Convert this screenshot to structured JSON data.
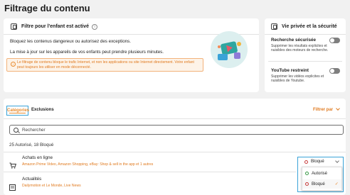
{
  "page": {
    "title": "Filtrage du contenu"
  },
  "child_filter": {
    "title": "Filtre pour l'enfant est activé",
    "line1": "Bloquez les contenus dangereux ou autorisez des exceptions.",
    "line2": "La mise à jour sur les appareils de vos enfants peut prendre plusieurs minutes.",
    "notice": "Le filtrage de contenu bloque le trafic Internet, et non les applications ou site Internet directement. Votre enfant peut toujours les utiliser en mode déconnecté."
  },
  "privacy": {
    "title": "Vie privée et la sécurité",
    "items": [
      {
        "title": "Recherche sécurisée",
        "desc": "Supprimer les résultats explicites et nuisibles des moteurs de recherche."
      },
      {
        "title": "YouTube restreint",
        "desc": "Supprimer les vidéos explicites et nuisibles de Youtube."
      }
    ]
  },
  "tabs": {
    "categories": "Catégories",
    "exclusions": "Exclusions",
    "filter_by": "Filtrer par"
  },
  "search": {
    "placeholder": "Rechercher"
  },
  "summary": {
    "count": "25 Autorisé, 18 Bloqué"
  },
  "categories": [
    {
      "title": "Achats en ligne",
      "sites": "Amazon Prime Video, Amazon Shopping, eBay: Shop & sell in the app et 1 autres",
      "status": "Bloqué"
    },
    {
      "title": "Actualités",
      "sites": "Dailymotion et Le Monde, Live News"
    }
  ],
  "status_options": [
    {
      "label": "Autorisé",
      "color": "#3a9a46"
    },
    {
      "label": "Bloqué",
      "color": "#c83c3c",
      "check": "✓"
    }
  ],
  "colors": {
    "accent": "#e88a2d",
    "focus": "#3aa3d8",
    "blocked": "#c83c3c",
    "allowed": "#3a9a46"
  }
}
